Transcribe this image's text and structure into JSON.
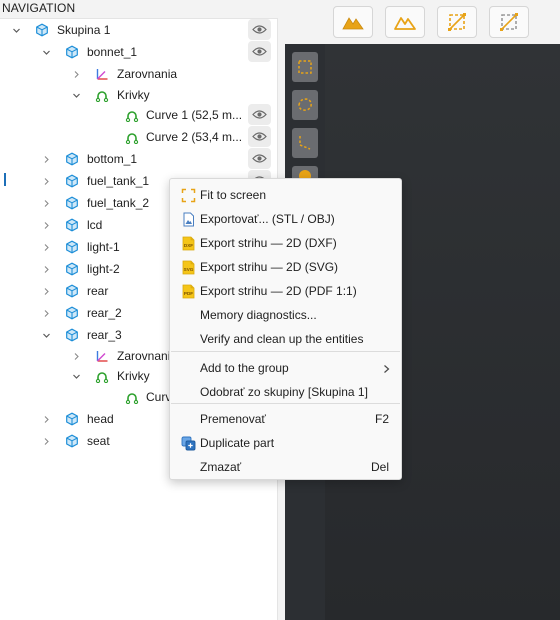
{
  "nav": {
    "title": "NAVIGATION",
    "rows": [
      {
        "label": "Skupina 1",
        "icon": "cube-icon",
        "caret": "down",
        "eye": true
      },
      {
        "label": "bonnet_1",
        "icon": "cube-icon",
        "caret": "down",
        "eye": true
      },
      {
        "label": "Zarovnania",
        "icon": "axes-icon",
        "caret": "right",
        "eye": false
      },
      {
        "label": "Krivky",
        "icon": "curve-icon",
        "caret": "down",
        "eye": false
      },
      {
        "label": "Curve 1  (52,5 m...",
        "icon": "curve-icon",
        "caret": "none",
        "eye": true
      },
      {
        "label": "Curve 2  (53,4 m...",
        "icon": "curve-icon",
        "caret": "none",
        "eye": true
      },
      {
        "label": "bottom_1",
        "icon": "cube-icon",
        "caret": "right",
        "eye": true
      },
      {
        "label": "fuel_tank_1",
        "icon": "cube-icon",
        "caret": "right",
        "eye": true
      },
      {
        "label": "fuel_tank_2",
        "icon": "cube-icon",
        "caret": "right",
        "eye": false
      },
      {
        "label": "lcd",
        "icon": "cube-icon",
        "caret": "right",
        "eye": false
      },
      {
        "label": "light-1",
        "icon": "cube-icon",
        "caret": "right",
        "eye": false
      },
      {
        "label": "light-2",
        "icon": "cube-icon",
        "caret": "right",
        "eye": false
      },
      {
        "label": "rear",
        "icon": "cube-icon",
        "caret": "right",
        "eye": false
      },
      {
        "label": "rear_2",
        "icon": "cube-icon",
        "caret": "right",
        "eye": false
      },
      {
        "label": "rear_3",
        "icon": "cube-icon",
        "caret": "down",
        "eye": false
      },
      {
        "label": "Zarovnania",
        "icon": "axes-icon",
        "caret": "right",
        "eye": false
      },
      {
        "label": "Krivky",
        "icon": "curve-icon",
        "caret": "down",
        "eye": false
      },
      {
        "label": "Curv",
        "icon": "curve-icon",
        "caret": "none",
        "eye": false
      },
      {
        "label": "head",
        "icon": "cube-icon",
        "caret": "right",
        "eye": false
      },
      {
        "label": "seat",
        "icon": "cube-icon",
        "caret": "right",
        "eye": false
      }
    ]
  },
  "toolbar": {
    "buttons": [
      "mountains-filled-icon",
      "mountains-outline-icon",
      "select-box-icon",
      "deselect-box-icon"
    ]
  },
  "viewport_tools": [
    "select-rect-icon",
    "select-lasso-icon",
    "select-path-icon",
    "orange-circle-icon"
  ],
  "context_menu": {
    "items": [
      {
        "label": "Fit to screen",
        "icon": "fit-screen-icon",
        "shortcut": ""
      },
      {
        "label": "Exportovať... (STL / OBJ)",
        "icon": "export-file-icon",
        "shortcut": ""
      },
      {
        "label": "Export strihu — 2D  (DXF)",
        "icon": "dxf-file-icon",
        "badge": "DXF",
        "shortcut": ""
      },
      {
        "label": "Export strihu — 2D  (SVG)",
        "icon": "svg-file-icon",
        "badge": "SVG",
        "shortcut": ""
      },
      {
        "label": "Export strihu — 2D  (PDF 1:1)",
        "icon": "pdf-file-icon",
        "badge": "PDF",
        "shortcut": ""
      },
      {
        "label": "Memory diagnostics...",
        "icon": "",
        "shortcut": ""
      },
      {
        "label": "Verify and clean up the entities",
        "icon": "",
        "shortcut": ""
      },
      {
        "label": "Add to the group",
        "icon": "",
        "shortcut": "",
        "submenu": true
      },
      {
        "label": "Odobrať zo skupiny  [Skupina 1]",
        "icon": "",
        "shortcut": ""
      },
      {
        "label": "Premenovať",
        "icon": "",
        "shortcut": "F2"
      },
      {
        "label": "Duplicate part",
        "icon": "duplicate-icon",
        "shortcut": ""
      },
      {
        "label": "Zmazať",
        "icon": "",
        "shortcut": "Del"
      }
    ]
  },
  "colors": {
    "cube": "#1f8fd8",
    "curve": "#2ca02c",
    "accent": "#e8a317",
    "viewport": "#2c2f33"
  }
}
